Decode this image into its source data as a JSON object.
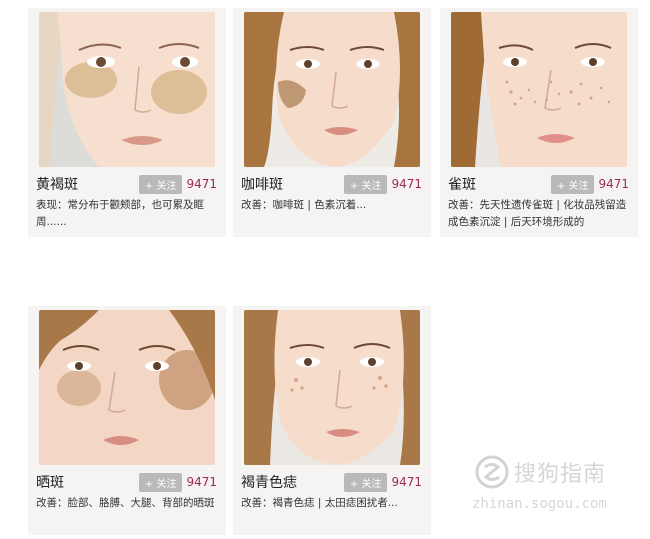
{
  "items": [
    {
      "name": "黄褐斑",
      "follow": "+ 关注",
      "count": "9471",
      "desc": "表现：常分布于颧颊部，也可累及眶周......"
    },
    {
      "name": "咖啡斑",
      "follow": "+ 关注",
      "count": "9471",
      "desc": "改善：咖啡斑 | 色素沉着..."
    },
    {
      "name": "雀斑",
      "follow": "+ 关注",
      "count": "9471",
      "desc": "改善：先天性遗传雀斑 | 化妆品残留造成色素沉淀 | 后天环境形成的"
    },
    {
      "name": "晒斑",
      "follow": "+ 关注",
      "count": "9471",
      "desc": "改善：脸部、胳膊、大腿、背部的晒斑"
    },
    {
      "name": "褐青色痣",
      "follow": "+ 关注",
      "count": "9471",
      "desc": "改善：褐青色痣 | 太田痣困扰者..."
    }
  ],
  "watermark": {
    "title": "搜狗指南",
    "url": "zhinan.sogou.com"
  }
}
